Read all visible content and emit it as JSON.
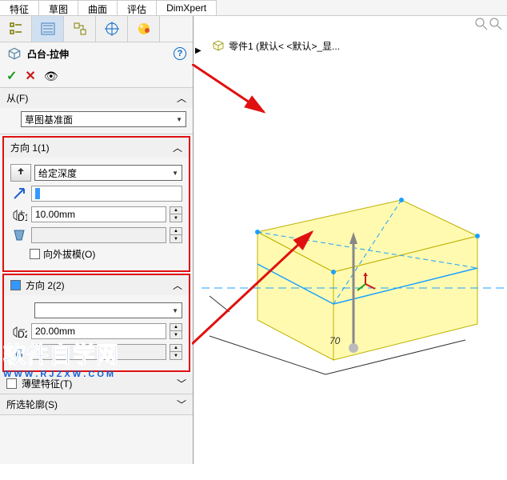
{
  "top_tabs": [
    "特征",
    "草图",
    "曲面",
    "评估",
    "DimXpert"
  ],
  "pm_title": "凸台-拉伸",
  "from": {
    "label": "从(F)",
    "value": "草图基准面"
  },
  "dir1": {
    "label": "方向 1(1)",
    "condition": "给定深度",
    "textval": "",
    "depth": "10.00mm",
    "draft_checked": false,
    "draft_label": "向外拔模(O)"
  },
  "dir2": {
    "label": "方向 2(2)",
    "condition": "",
    "depth": "20.00mm",
    "checked": true
  },
  "thinwall": {
    "label": "薄壁特征(T)",
    "checked": false
  },
  "contours": {
    "label": "所选轮廓(S)"
  },
  "part_label": "零件1  (默认< <默认>_显...",
  "watermark": {
    "cn": "软件自学网",
    "en": "W W W . R J Z X W . C O M"
  },
  "box3d": {
    "width": 70
  }
}
